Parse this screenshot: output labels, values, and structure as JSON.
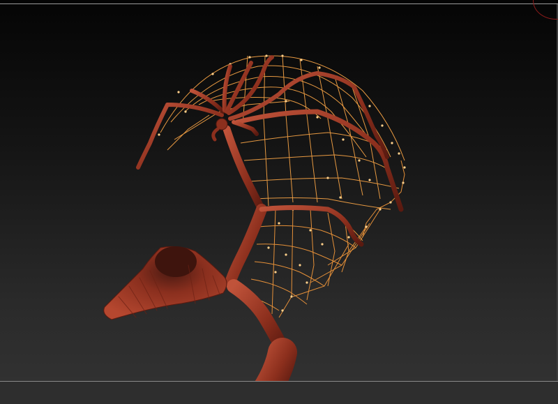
{
  "viewport": {
    "background_top": "#050505",
    "background_bottom": "#333333",
    "frame_line_color": "#9a9a9a",
    "model_color": "#9c3a24",
    "wireframe_color": "#f29a3c",
    "cursor_color": "#8b1a1a"
  },
  "scene": {
    "icons": [
      "zsphere-model",
      "wireframe-web",
      "brush-cursor"
    ]
  }
}
